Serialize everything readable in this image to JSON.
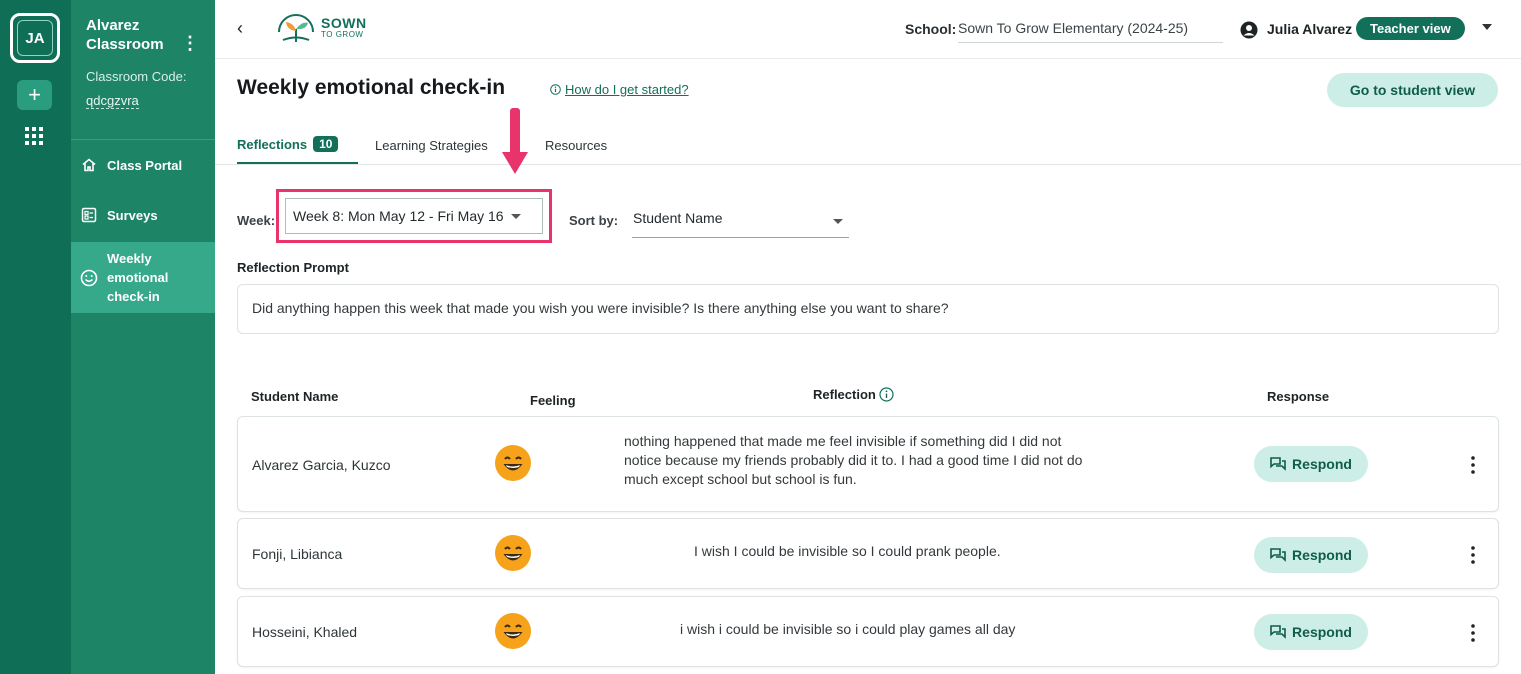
{
  "rail": {
    "avatar_initials": "JA",
    "add_symbol": "+",
    "icons": [
      "plus-icon",
      "apps-grid-icon"
    ]
  },
  "sidebar": {
    "class_name": "Alvarez Classroom",
    "code_label": "Classroom Code:",
    "code_value": "qdcgzvra",
    "items": [
      {
        "label": "Class Portal",
        "icon": "home-icon"
      },
      {
        "label": "Surveys",
        "icon": "survey-icon"
      },
      {
        "label": "Weekly emotional check-in",
        "icon": "smiley-icon",
        "active": true
      }
    ]
  },
  "header": {
    "logo_line1": "SOWN",
    "logo_line2": "TO GROW",
    "school_label": "School:",
    "school_value": "Sown To Grow Elementary (2024-25)",
    "user_name": "Julia Alvarez",
    "view_badge": "Teacher view"
  },
  "page": {
    "title": "Weekly emotional check-in",
    "help_link": "How do I get started?",
    "student_view_button": "Go to student view"
  },
  "tabs": [
    {
      "label": "Reflections",
      "count": "10",
      "active": true
    },
    {
      "label": "Learning Strategies"
    },
    {
      "label": "Resources"
    }
  ],
  "filters": {
    "week_label": "Week:",
    "week_value": "Week 8: Mon May 12 - Fri May 16",
    "sort_label": "Sort by:",
    "sort_value": "Student Name"
  },
  "prompt": {
    "label": "Reflection Prompt",
    "text": "Did anything happen this week that made you wish you were invisible? Is there anything else you want to share?"
  },
  "table": {
    "headers": {
      "name": "Student Name",
      "feeling": "Feeling",
      "reflection": "Reflection",
      "response": "Response"
    },
    "rows": [
      {
        "name": "Alvarez Garcia, Kuzco",
        "feeling": "grinning-face",
        "reflection": "nothing happened that made me feel invisible if something did I did not notice because my friends probably did it to. I had a good time I did not do much except school but school is fun.",
        "action": "Respond"
      },
      {
        "name": "Fonji, Libianca",
        "feeling": "grinning-face",
        "reflection": "I wish I could be invisible so I could prank people.",
        "action": "Respond"
      },
      {
        "name": "Hosseini, Khaled",
        "feeling": "grinning-face",
        "reflection": "i wish i could be invisible so i could play games all day",
        "action": "Respond"
      }
    ]
  },
  "colors": {
    "brand_dark": "#0f6e56",
    "sidebar": "#1e8466",
    "sidebar_active": "#36a98b",
    "highlight": "#e8336b",
    "pill_light": "#cdeee6",
    "emoji": "#f7a21b"
  }
}
